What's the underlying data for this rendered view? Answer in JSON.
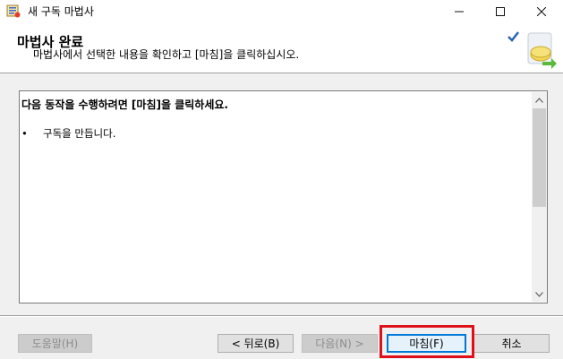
{
  "window": {
    "title": "새 구독 마법사"
  },
  "header": {
    "title": "마법사 완료",
    "subtitle": "마법사에서 선택한 내용을 확인하고 [마침]을 클릭하십시오."
  },
  "content": {
    "heading": "다음 동작을 수행하려면 [마침]을 클릭하세요.",
    "bullet_text": "구독을 만듭니다.",
    "bullet_symbol": "•"
  },
  "buttons": {
    "help": "도움말(H)",
    "back": "< 뒤로(B)",
    "next": "다음(N) >",
    "finish": "마침(F)",
    "cancel": "취소"
  },
  "colors": {
    "highlight": "#e0101a",
    "focus": "#0078d7"
  }
}
